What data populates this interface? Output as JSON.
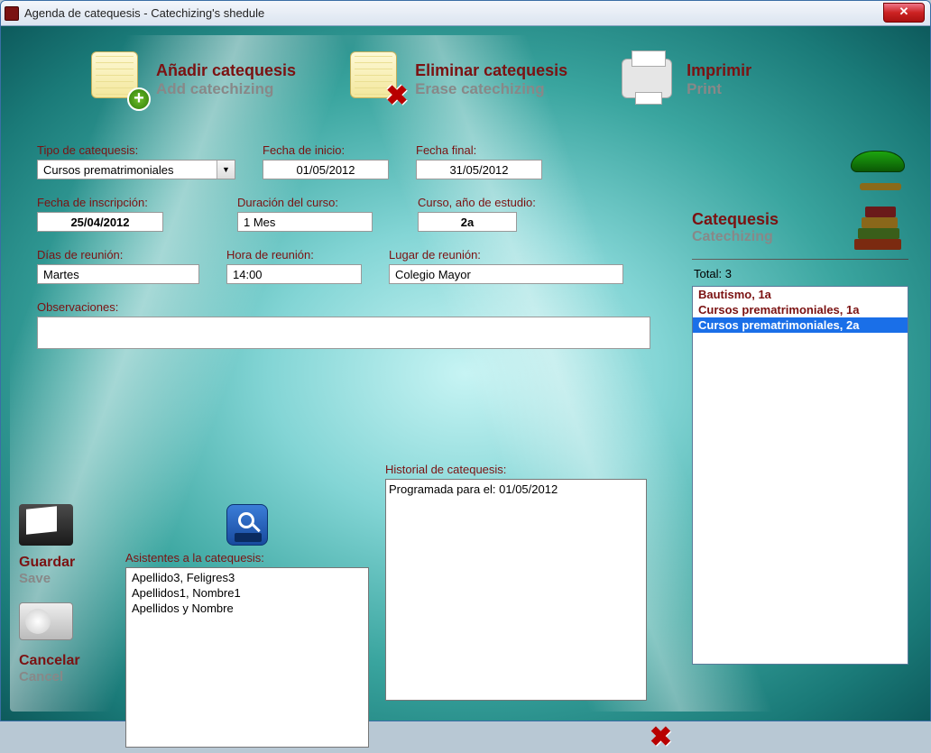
{
  "window": {
    "title": "Agenda de catequesis - Catechizing's shedule"
  },
  "toolbar": {
    "add": {
      "es": "Añadir catequesis",
      "en": "Add catechizing"
    },
    "erase": {
      "es": "Eliminar catequesis",
      "en": "Erase catechizing"
    },
    "print": {
      "es": "Imprimir",
      "en": "Print"
    }
  },
  "form": {
    "tipo": {
      "label": "Tipo de catequesis:",
      "value": "Cursos prematrimoniales"
    },
    "fechaInicio": {
      "label": "Fecha de inicio:",
      "value": "01/05/2012"
    },
    "fechaFinal": {
      "label": "Fecha final:",
      "value": "31/05/2012"
    },
    "fechaInscr": {
      "label": "Fecha de inscripción:",
      "value": "25/04/2012"
    },
    "duracion": {
      "label": "Duración del curso:",
      "value": "1 Mes"
    },
    "curso": {
      "label": "Curso, año de estudio:",
      "value": "2a"
    },
    "dias": {
      "label": "Días de reunión:",
      "value": "Martes"
    },
    "hora": {
      "label": "Hora de reunión:",
      "value": "14:00"
    },
    "lugar": {
      "label": "Lugar de reunión:",
      "value": "Colegio Mayor"
    },
    "obs": {
      "label": "Observaciones:",
      "value": ""
    }
  },
  "asistentes": {
    "label": "Asistentes a la catequesis:",
    "items": [
      "Apellido3, Feligres3",
      "Apellidos1, Nombre1",
      "Apellidos y Nombre"
    ]
  },
  "historial": {
    "label": "Historial de catequesis:",
    "items": [
      "Programada para el: 01/05/2012"
    ]
  },
  "sideActions": {
    "save": {
      "es": "Guardar",
      "en": "Save"
    },
    "cancel": {
      "es": "Cancelar",
      "en": "Cancel"
    }
  },
  "rightPanel": {
    "title": {
      "es": "Catequesis",
      "en": "Catechizing"
    },
    "totalLabel": "Total:",
    "total": "3",
    "items": [
      {
        "text": "Bautismo, 1a",
        "selected": false
      },
      {
        "text": "Cursos prematrimoniales, 1a",
        "selected": false
      },
      {
        "text": "Cursos prematrimoniales, 2a",
        "selected": true
      }
    ]
  }
}
